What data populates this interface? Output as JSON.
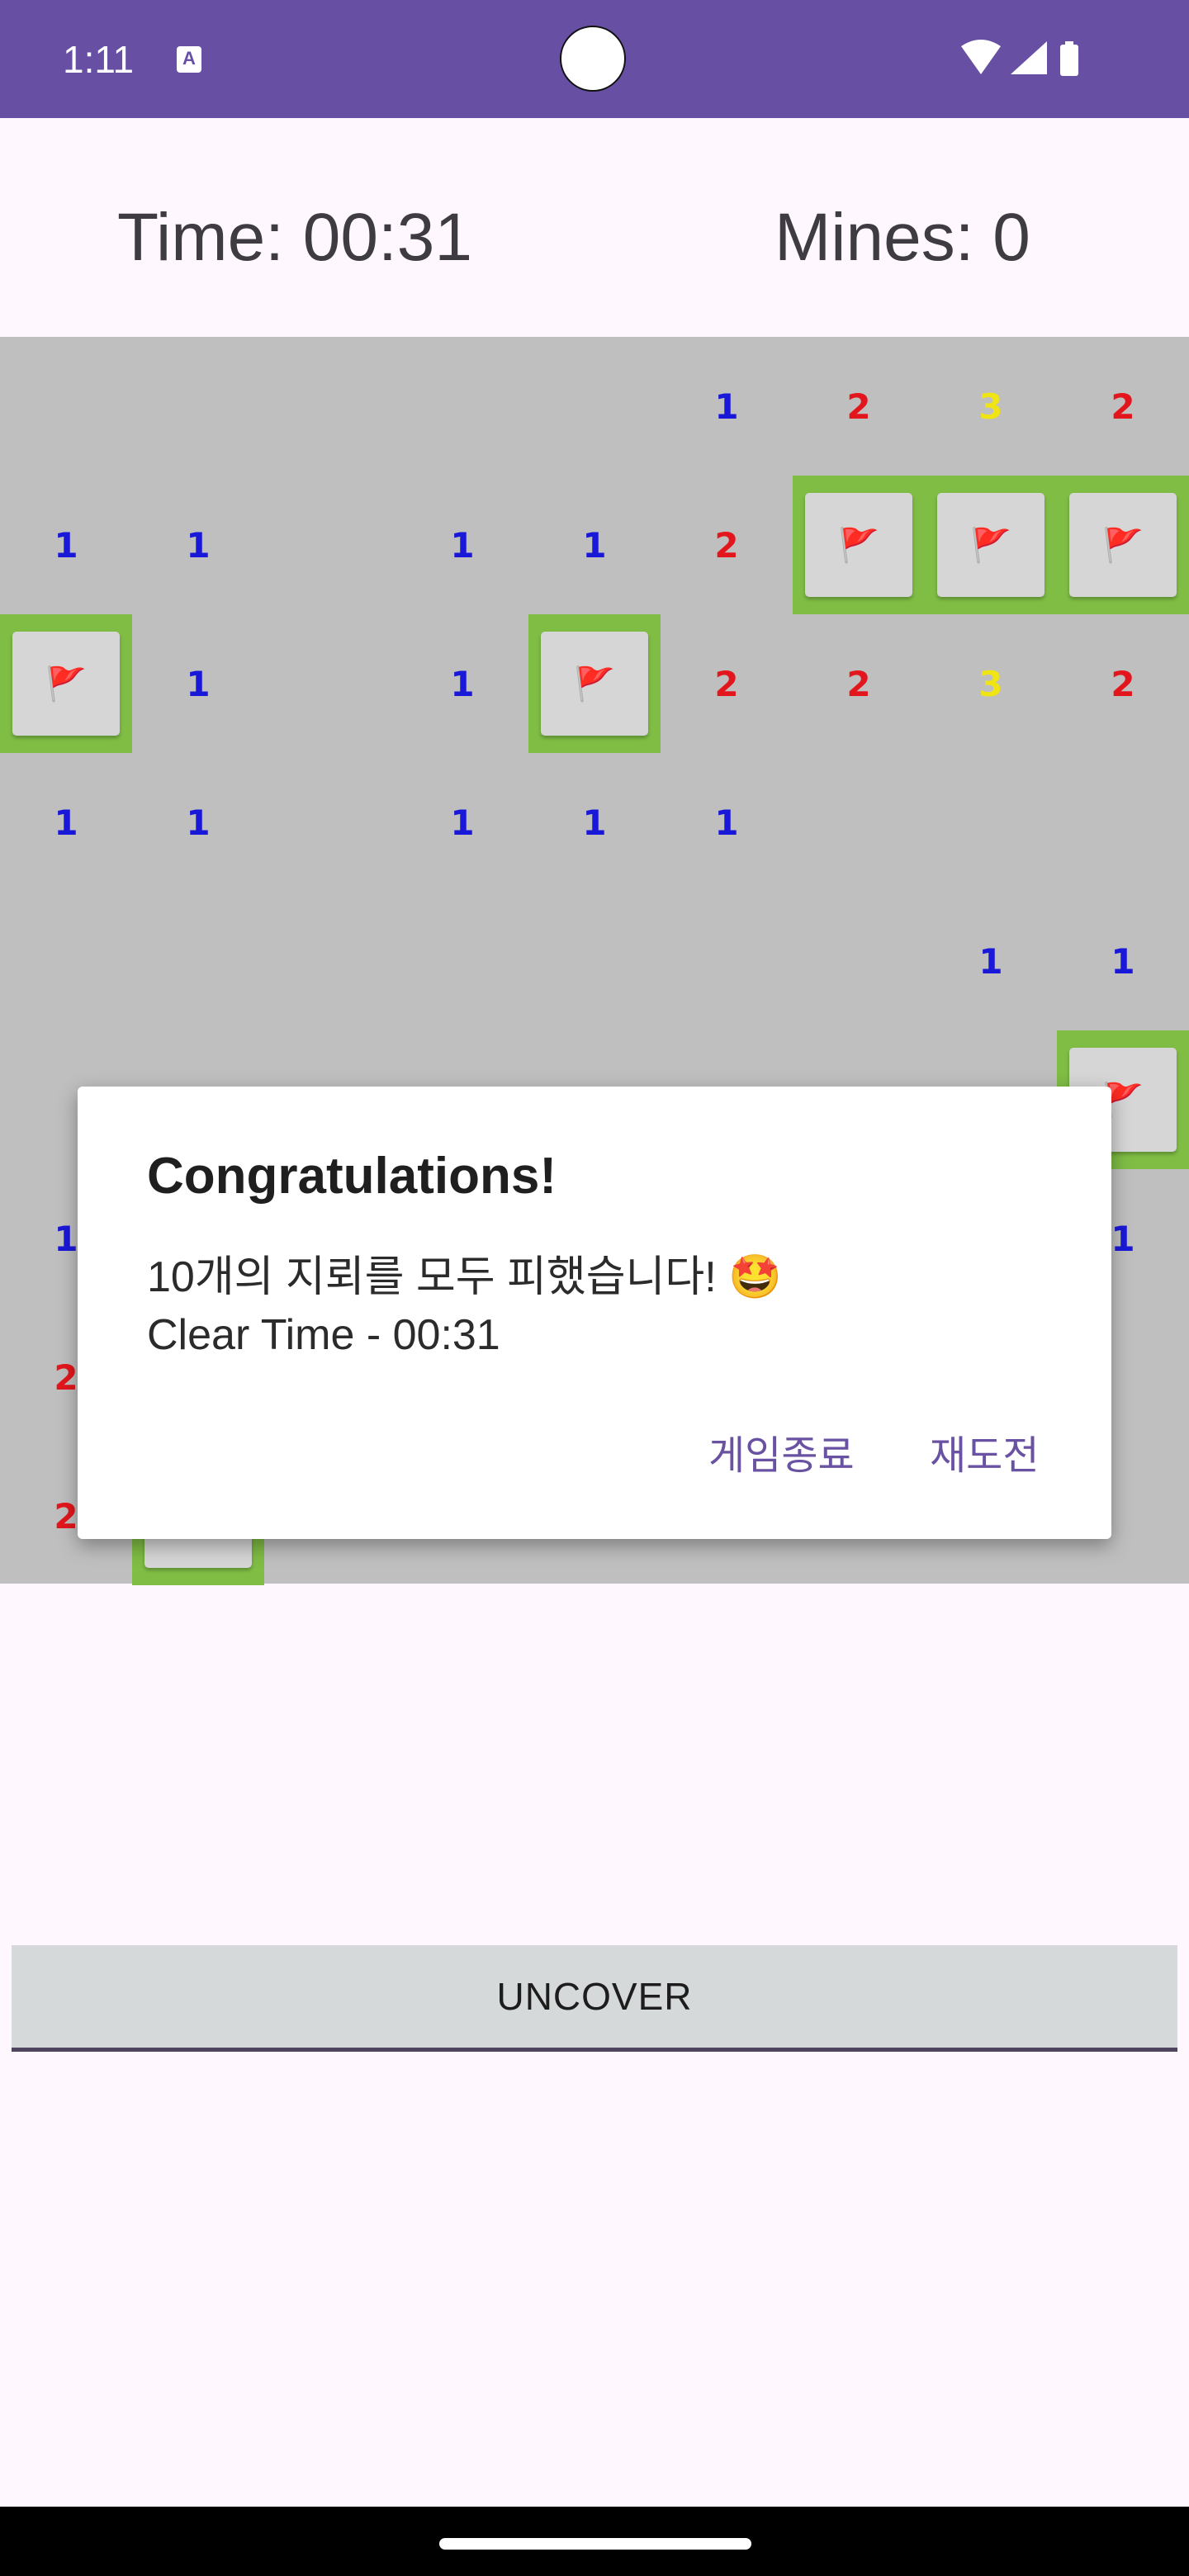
{
  "status_bar": {
    "time": "1:11",
    "notification_icon": "a-keyboard-icon",
    "icons": [
      "wifi-icon",
      "signal-icon",
      "battery-icon"
    ]
  },
  "header": {
    "time_label": "Time: 00:31",
    "mines_label": "Mines: 0"
  },
  "board": {
    "colors": {
      "one": "#1a18d8",
      "two": "#e4161d",
      "three": "#f1e414",
      "flag_bg": "#7fbd45",
      "tile": "#d6d6d6"
    },
    "cells": [
      [
        "",
        "",
        "",
        "",
        "",
        "1",
        "2",
        "3",
        "2"
      ],
      [
        "1",
        "1",
        "",
        "1",
        "1",
        "2",
        "F",
        "F",
        "F"
      ],
      [
        "F",
        "1",
        "",
        "1",
        "F",
        "2",
        "2",
        "3",
        "2"
      ],
      [
        "1",
        "1",
        "",
        "1",
        "1",
        "1",
        "",
        "",
        ""
      ],
      [
        "",
        "",
        "",
        "",
        "",
        "",
        "",
        "1",
        "1"
      ],
      [
        "",
        "",
        "",
        "",
        "",
        "",
        "",
        "",
        "F"
      ],
      [
        "1",
        "",
        "",
        "",
        "",
        "",
        "",
        "",
        "1"
      ],
      [
        "2",
        "",
        "",
        "",
        "",
        "",
        "",
        "",
        ""
      ],
      [
        "2",
        "T",
        "",
        "",
        "",
        "",
        "",
        "",
        ""
      ]
    ]
  },
  "dialog": {
    "title": "Congratulations!",
    "message": "10개의 지뢰를 모두 피했습니다! 🤩\nClear Time - 00:31",
    "quit_label": "게임종료",
    "retry_label": "재도전"
  },
  "uncover_label": "UNCOVER"
}
